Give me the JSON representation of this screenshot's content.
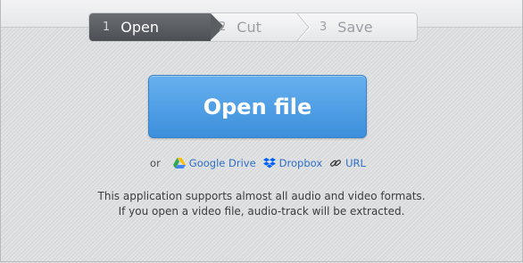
{
  "steps": [
    {
      "num": "1",
      "label": "Open",
      "active": true
    },
    {
      "num": "2",
      "label": "Cut",
      "active": false
    },
    {
      "num": "3",
      "label": "Save",
      "active": false
    }
  ],
  "open_button": {
    "label": "Open file"
  },
  "sources": {
    "or": "or",
    "google_drive": "Google Drive",
    "dropbox": "Dropbox",
    "url": "URL"
  },
  "info": {
    "line1": "This application supports almost all audio and video formats.",
    "line2": "If you open a video file, audio-track will be extracted."
  },
  "colors": {
    "accent": "#4a9be3",
    "link": "#2f6fc7",
    "active_step": "#5a5d62",
    "google_drive_green": "#34a853",
    "google_drive_yellow": "#fbbc04",
    "google_drive_blue": "#4285f4",
    "dropbox_blue": "#0061fe"
  },
  "icons": {
    "google_drive": "google-drive-icon",
    "dropbox": "dropbox-icon",
    "url": "link-icon"
  }
}
